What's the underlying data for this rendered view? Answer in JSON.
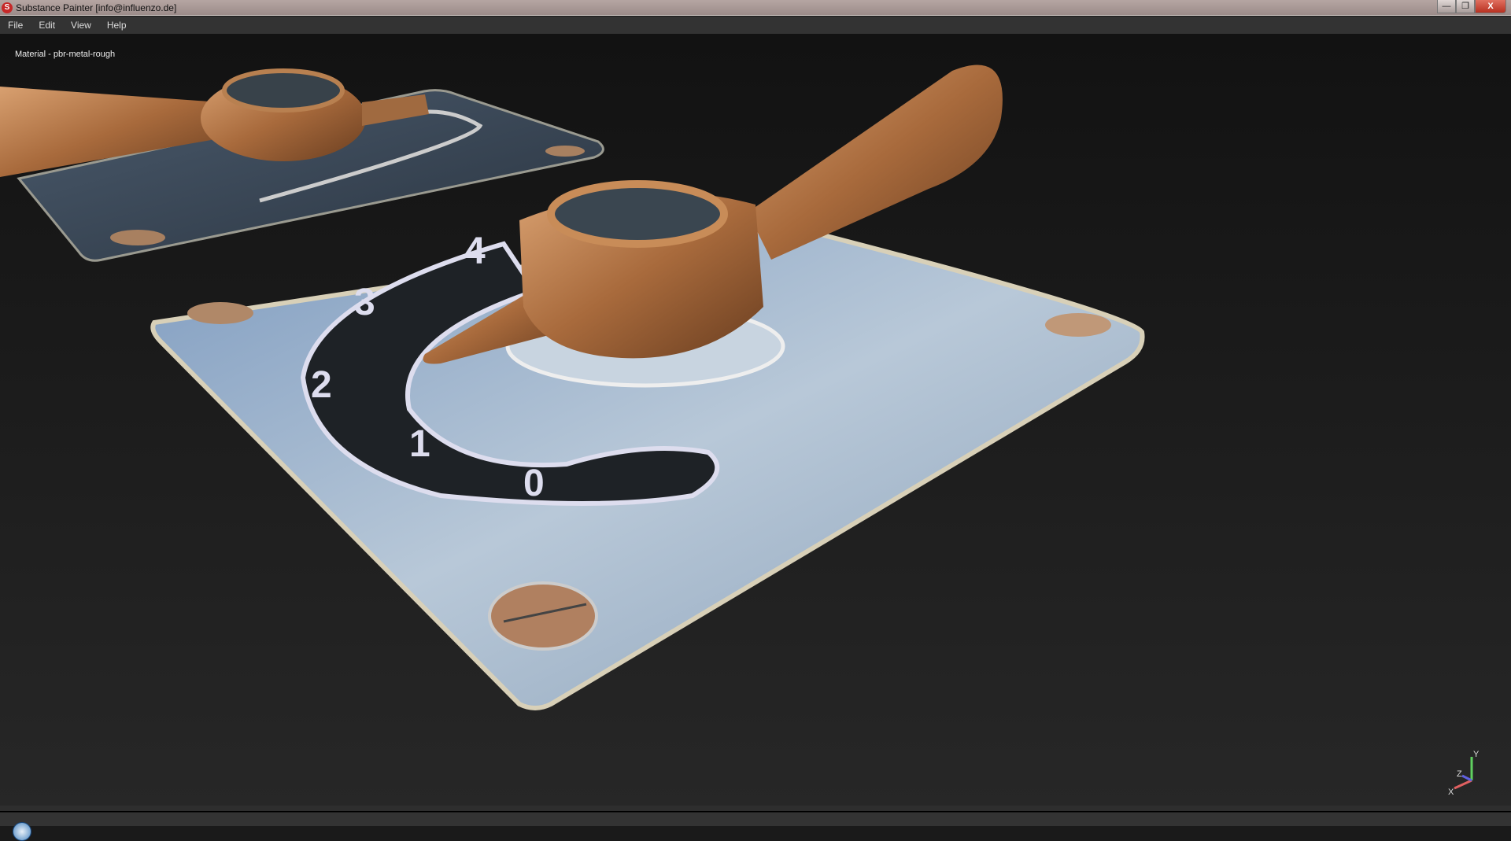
{
  "window": {
    "title": "Substance Painter [info@influenzo.de]",
    "app_icon": "substance-painter-logo",
    "controls": {
      "minimize": "—",
      "restore": "❐",
      "close": "X"
    }
  },
  "menu": [
    "File",
    "Edit",
    "View",
    "Help"
  ],
  "viewport": {
    "material_label": "Material - pbr-metal-rough",
    "dial_numbers": [
      "0",
      "1",
      "2",
      "3",
      "4"
    ],
    "axis": {
      "x": "X",
      "y": "Y",
      "z": "Z"
    }
  },
  "colors": {
    "axis_x": "#e06060",
    "axis_y": "#60d060",
    "axis_z": "#6060e0",
    "close": "#c83a28"
  }
}
